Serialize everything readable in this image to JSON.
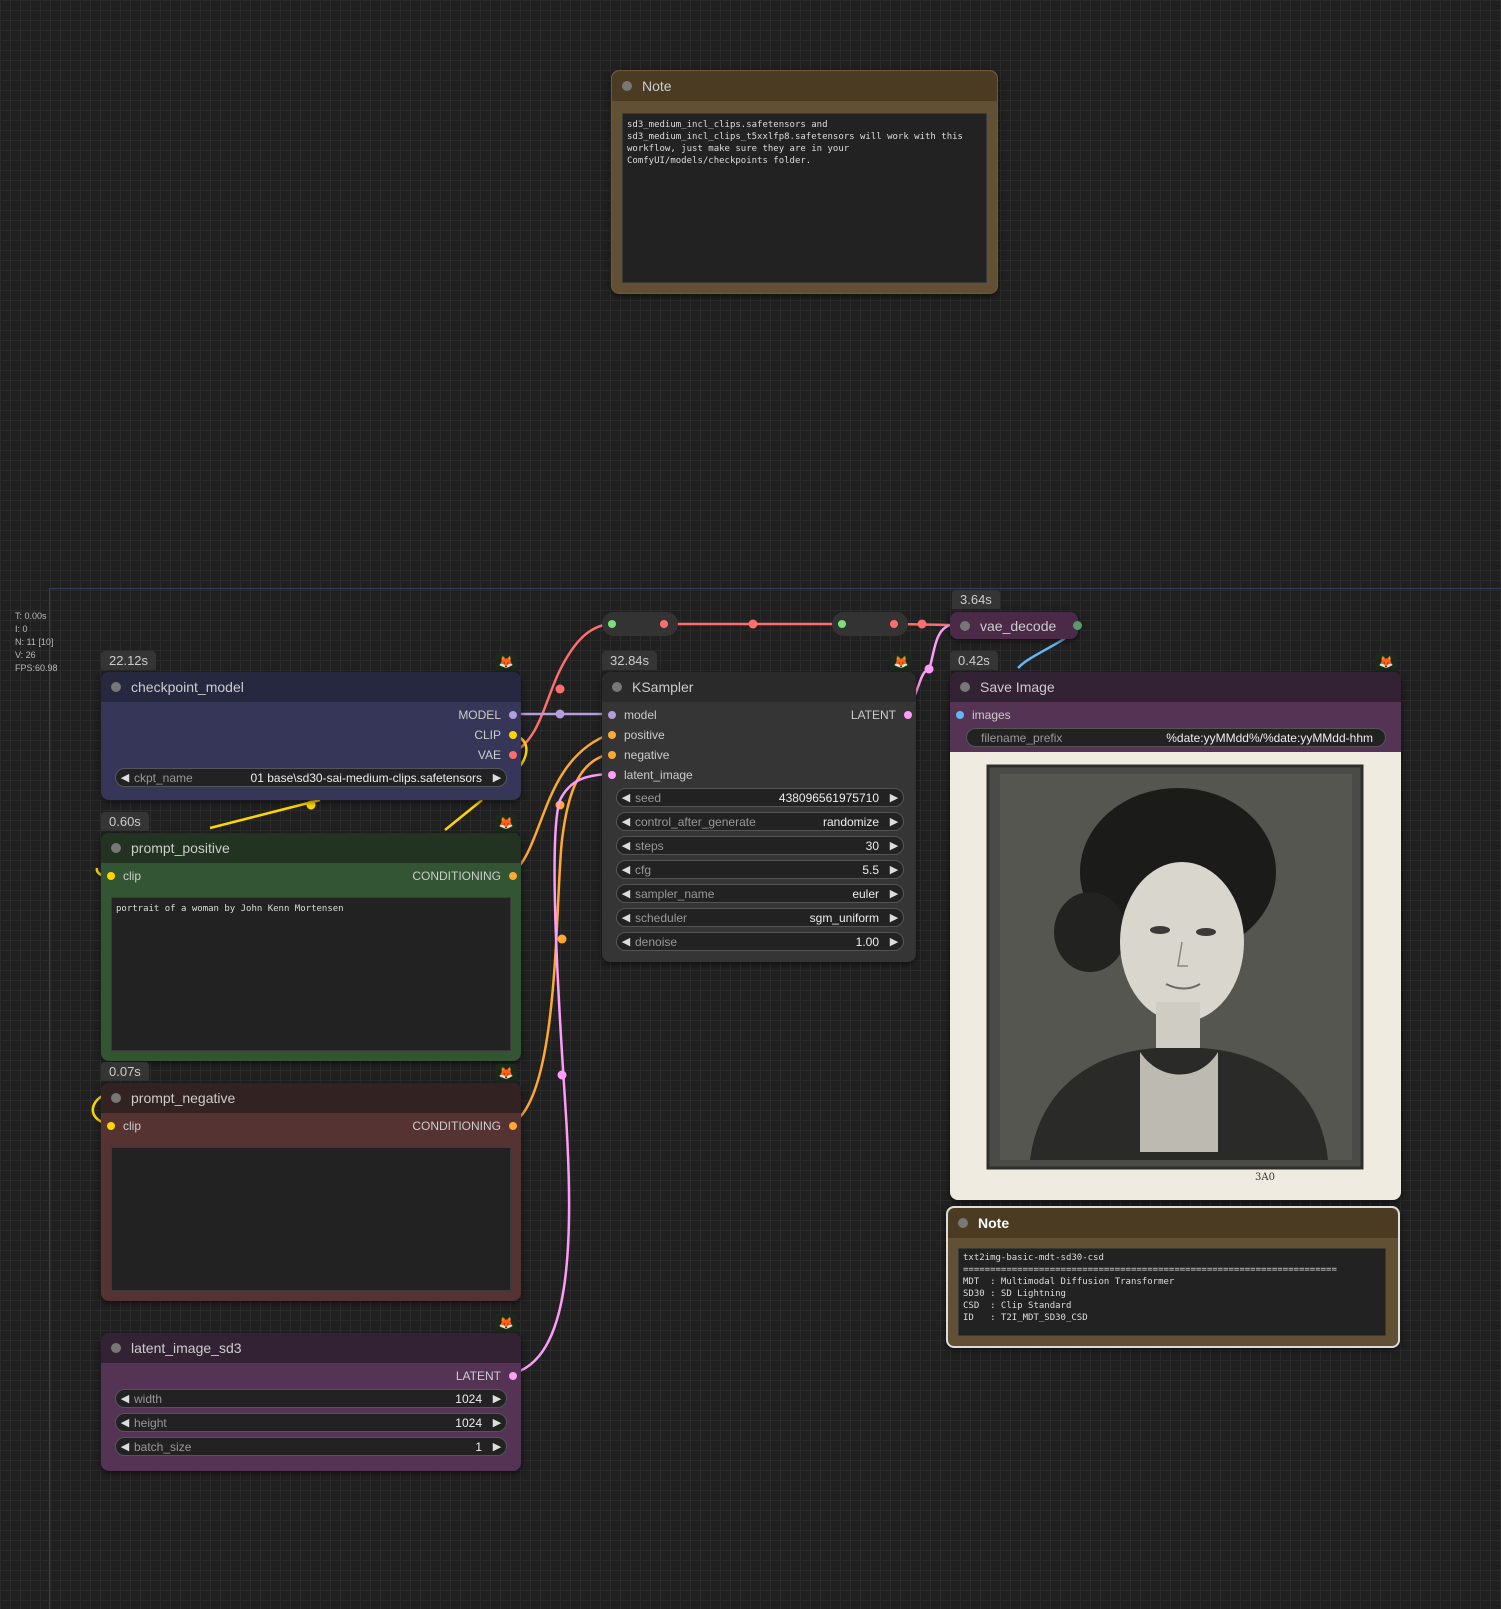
{
  "stats": {
    "time": "T: 0.00s",
    "iter": "I: 0",
    "nodes": "N: 11 [10]",
    "vertices": "V: 26",
    "fps": "FPS:60.98"
  },
  "colors": {
    "model": "#b39ddb",
    "clip": "#ffd500",
    "vae": "#ff6e6e",
    "conditioning": "#ffa931",
    "latent": "#ff9cf9",
    "image": "#64b5f6"
  },
  "note_top": {
    "title": "Note",
    "text": "sd3_medium_incl_clips.safetensors and\nsd3_medium_incl_clips_t5xxlfp8.safetensors will work with this\nworkflow, just make sure they are in your\nComfyUI/models/checkpoints folder."
  },
  "checkpoint": {
    "time": "22.12s",
    "title": "checkpoint_model",
    "outputs": [
      "MODEL",
      "CLIP",
      "VAE"
    ],
    "ckpt_label": "ckpt_name",
    "ckpt_value": "01 base\\sd30-sai-medium-clips.safetensors"
  },
  "prompt_positive": {
    "time": "0.60s",
    "title": "prompt_positive",
    "input": "clip",
    "output": "CONDITIONING",
    "text": "portrait of a woman by John Kenn Mortensen"
  },
  "prompt_negative": {
    "time": "0.07s",
    "title": "prompt_negative",
    "input": "clip",
    "output": "CONDITIONING",
    "text": ""
  },
  "latent": {
    "title": "latent_image_sd3",
    "output": "LATENT",
    "widgets": [
      {
        "label": "width",
        "value": "1024"
      },
      {
        "label": "height",
        "value": "1024"
      },
      {
        "label": "batch_size",
        "value": "1"
      }
    ]
  },
  "ksampler": {
    "time": "32.84s",
    "title": "KSampler",
    "inputs": [
      "model",
      "positive",
      "negative",
      "latent_image"
    ],
    "output": "LATENT",
    "widgets": [
      {
        "label": "seed",
        "value": "438096561975710"
      },
      {
        "label": "control_after_generate",
        "value": "randomize"
      },
      {
        "label": "steps",
        "value": "30"
      },
      {
        "label": "cfg",
        "value": "5.5"
      },
      {
        "label": "sampler_name",
        "value": "euler"
      },
      {
        "label": "scheduler",
        "value": "sgm_uniform"
      },
      {
        "label": "denoise",
        "value": "1.00"
      }
    ]
  },
  "vae_decode": {
    "time": "3.64s",
    "title": "vae_decode"
  },
  "save_image": {
    "time": "0.42s",
    "title": "Save Image",
    "input": "images",
    "prefix_label": "filename_prefix",
    "prefix_value": "%date:yyMMdd%/%date:yyMMdd-hhm",
    "sig": "3A0"
  },
  "note_bottom": {
    "title": "Note",
    "text": "txt2img-basic-mdt-sd30-csd\n=====================================================================\nMDT  : Multimodal Diffusion Transformer\nSD30 : SD Lightning\nCSD  : Clip Standard\nID   : T2I_MDT_SD30_CSD"
  }
}
